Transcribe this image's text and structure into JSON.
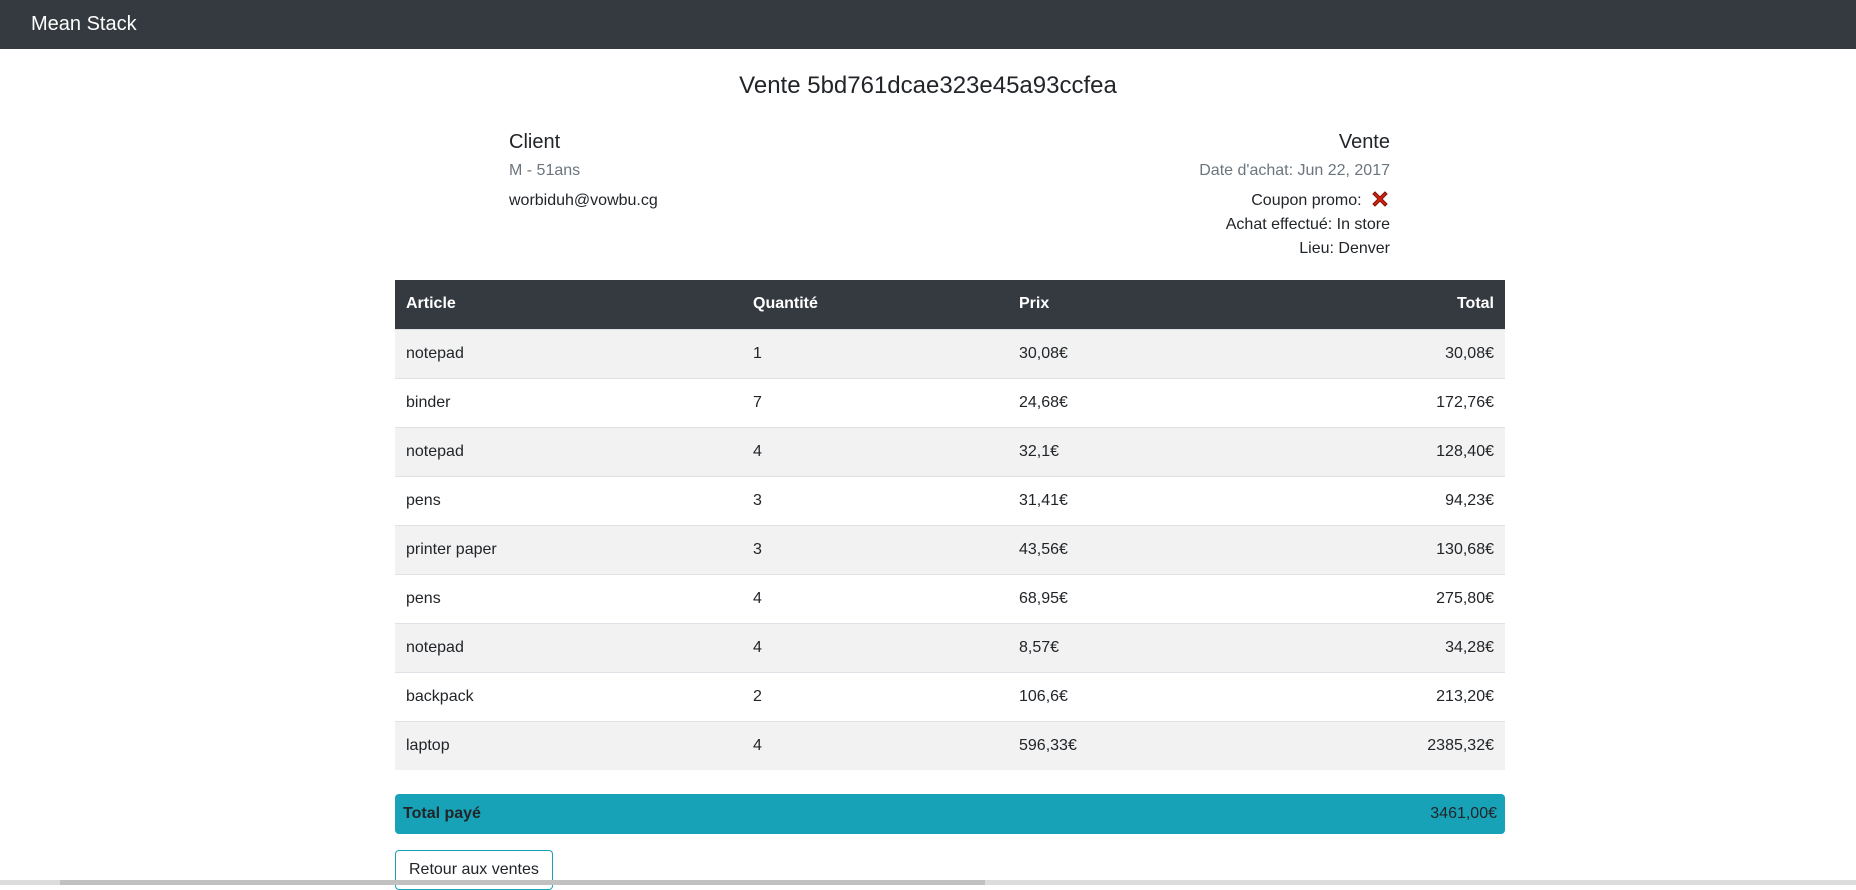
{
  "navbar": {
    "brand": "Mean Stack"
  },
  "page": {
    "title": "Vente 5bd761dcae323e45a93ccfea"
  },
  "client": {
    "heading": "Client",
    "subtitle": "M - 51ans",
    "email": "worbiduh@vowbu.cg"
  },
  "vente": {
    "heading": "Vente",
    "date": "Date d'achat: Jun 22, 2017",
    "coupon_label": "Coupon promo:",
    "coupon_icon": "cross-mark-icon",
    "coupon_color": "#d9230f",
    "achat": "Achat effectué: In store",
    "lieu": "Lieu: Denver"
  },
  "table": {
    "headers": [
      "Article",
      "Quantité",
      "Prix",
      "Total"
    ],
    "rows": [
      {
        "article": "notepad",
        "quantite": "1",
        "prix": "30,08€",
        "total": "30,08€"
      },
      {
        "article": "binder",
        "quantite": "7",
        "prix": "24,68€",
        "total": "172,76€"
      },
      {
        "article": "notepad",
        "quantite": "4",
        "prix": "32,1€",
        "total": "128,40€"
      },
      {
        "article": "pens",
        "quantite": "3",
        "prix": "31,41€",
        "total": "94,23€"
      },
      {
        "article": "printer paper",
        "quantite": "3",
        "prix": "43,56€",
        "total": "130,68€"
      },
      {
        "article": "pens",
        "quantite": "4",
        "prix": "68,95€",
        "total": "275,80€"
      },
      {
        "article": "notepad",
        "quantite": "4",
        "prix": "8,57€",
        "total": "34,28€"
      },
      {
        "article": "backpack",
        "quantite": "2",
        "prix": "106,6€",
        "total": "213,20€"
      },
      {
        "article": "laptop",
        "quantite": "4",
        "prix": "596,33€",
        "total": "2385,32€"
      }
    ]
  },
  "summary": {
    "label": "Total payé",
    "value": "3461,00€",
    "color": "#17a2b8"
  },
  "actions": {
    "back_label": "Retour aux ventes"
  }
}
